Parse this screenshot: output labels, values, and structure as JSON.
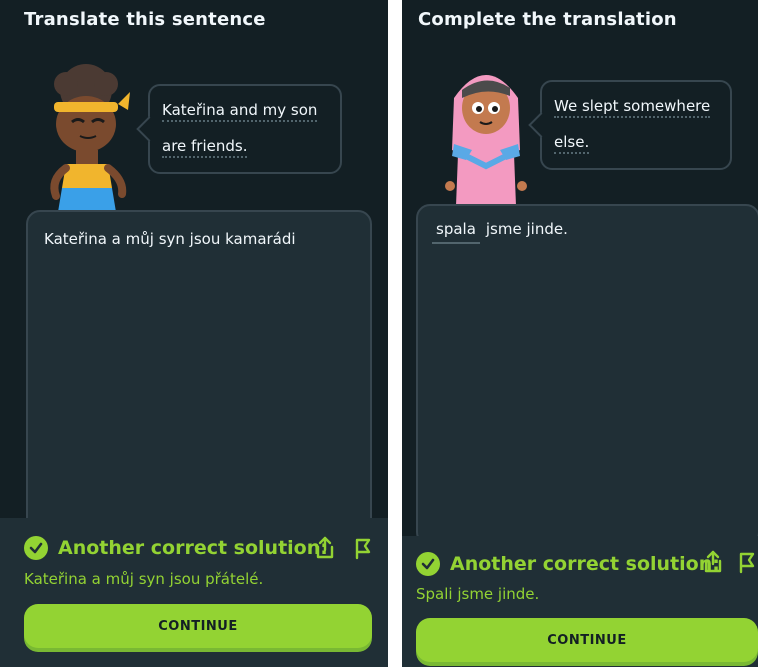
{
  "colors": {
    "background": "#131f24",
    "panel": "#202f36",
    "border": "#37464f",
    "accent_green": "#93d333",
    "text": "#f1f7fb"
  },
  "left": {
    "title": "Translate this sentence",
    "bubble_line1": "Kateřina and my son",
    "bubble_line2": "are friends.",
    "answer_text": "Kateřina a můj syn jsou kamarádi",
    "feedback_title": "Another correct solution:",
    "feedback_solution": "Kateřina a můj syn jsou přátelé.",
    "continue_label": "CONTINUE",
    "share_icon": "share-icon",
    "report_icon": "flag-icon"
  },
  "right": {
    "title": "Complete the translation",
    "bubble_line1": "We slept somewhere",
    "bubble_line2": "else.",
    "blank_word": "spala",
    "rest_text": "jsme jinde.",
    "feedback_title": "Another correct solution:",
    "feedback_solution": "Spali jsme jinde.",
    "continue_label": "CONTINUE",
    "share_icon": "share-icon",
    "report_icon": "flag-icon"
  }
}
